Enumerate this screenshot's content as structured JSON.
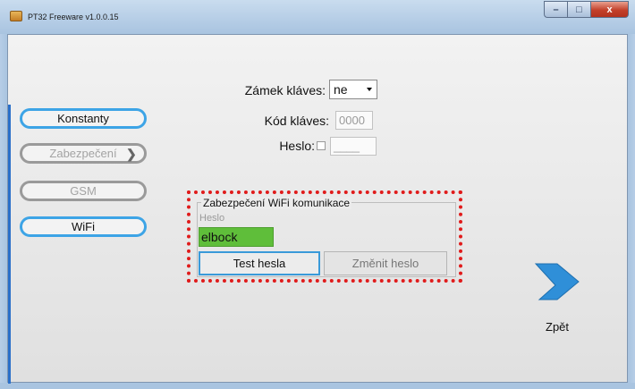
{
  "window": {
    "title": "PT32 Freeware v1.0.0.15",
    "controls": {
      "minimize": "–",
      "maximize": "□",
      "close": "x"
    }
  },
  "nav": {
    "items": [
      {
        "label": "Konstanty",
        "enabled": true
      },
      {
        "label": "Zabezpečení",
        "enabled": false,
        "chevron": "❯"
      },
      {
        "label": "GSM",
        "enabled": false
      },
      {
        "label": "WiFi",
        "enabled": true
      }
    ]
  },
  "form": {
    "key_lock": {
      "label": "Zámek kláves:",
      "value": "ne"
    },
    "key_code": {
      "label": "Kód kláves:",
      "value": "0000"
    },
    "password": {
      "label": "Heslo:",
      "checked": false,
      "value": "____"
    }
  },
  "wifi_group": {
    "title": "Zabezpečení WiFi komunikace",
    "password_label": "Heslo",
    "password_value": "elbock",
    "test_button": "Test hesla",
    "change_button": "Změnit heslo"
  },
  "back": {
    "label": "Zpět"
  },
  "colors": {
    "accent": "#3da4e6",
    "highlight_border": "#e01b1b",
    "password_fill": "#5fbe3a",
    "back_arrow": "#2f8fd8"
  }
}
